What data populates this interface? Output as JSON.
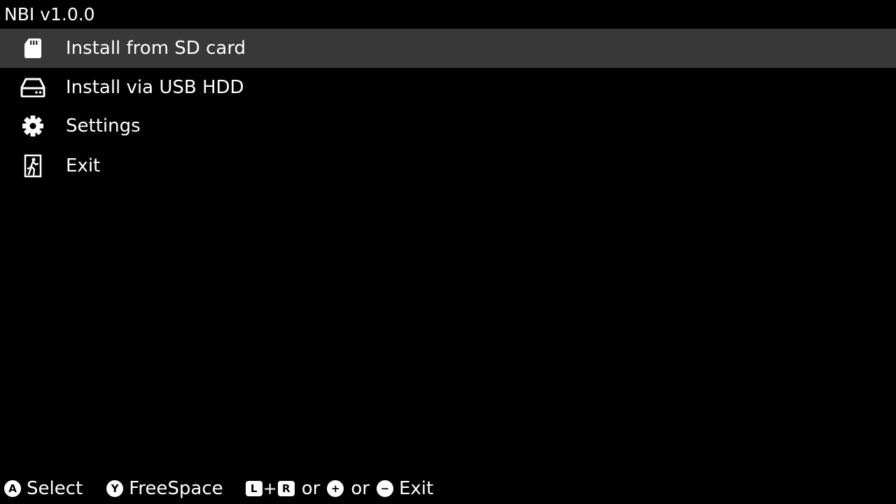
{
  "app": {
    "title": "NBI v1.0.0"
  },
  "colors": {
    "background": "#000000",
    "selected_row": "#383838",
    "text": "#ffffff"
  },
  "menu": {
    "selected_index": 0,
    "items": [
      {
        "label": "Install from SD card",
        "icon": "sd-card-icon"
      },
      {
        "label": "Install via USB HDD",
        "icon": "hard-drive-icon"
      },
      {
        "label": "Settings",
        "icon": "gear-icon"
      },
      {
        "label": "Exit",
        "icon": "exit-door-icon"
      }
    ]
  },
  "footer": {
    "select": {
      "button": "A",
      "label": "Select"
    },
    "freespace": {
      "button": "Y",
      "label": "FreeSpace"
    },
    "exit": {
      "button_l": "L",
      "plus_sign": "+",
      "button_r": "R",
      "or_1": "or",
      "button_plus": "+",
      "or_2": "or",
      "button_minus": "−",
      "label": "Exit"
    }
  }
}
